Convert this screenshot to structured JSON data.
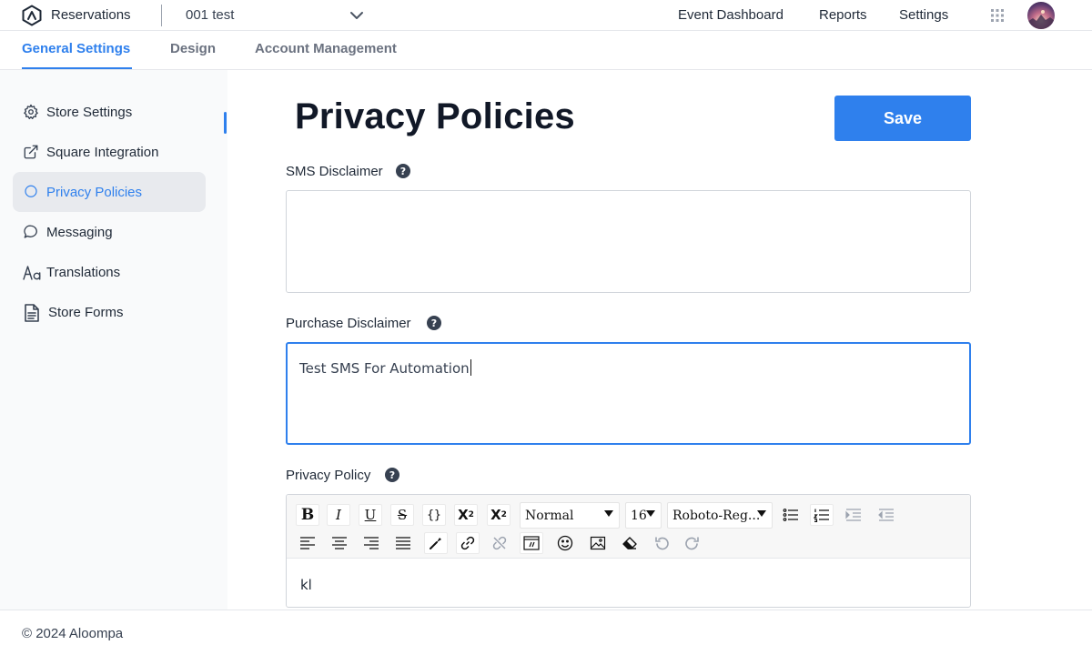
{
  "header": {
    "app_name": "Reservations",
    "store_name": "001 test",
    "nav": [
      "Event Dashboard",
      "Reports",
      "Settings"
    ]
  },
  "tabs": [
    {
      "label": "General Settings",
      "active": true
    },
    {
      "label": "Design",
      "active": false
    },
    {
      "label": "Account Management",
      "active": false
    }
  ],
  "sidebar": {
    "items": [
      {
        "label": "Store Settings",
        "icon": "gear-icon"
      },
      {
        "label": "Square Integration",
        "icon": "external-link-icon"
      },
      {
        "label": "Privacy Policies",
        "icon": "circle-icon",
        "active": true
      },
      {
        "label": "Messaging",
        "icon": "chat-bubble-icon"
      },
      {
        "label": "Translations",
        "icon": "font-aa-icon"
      },
      {
        "label": "Store Forms",
        "icon": "document-icon"
      }
    ]
  },
  "main": {
    "title": "Privacy Policies",
    "save_label": "Save",
    "sms_label": "SMS Disclaimer",
    "sms_value": "",
    "purchase_label": "Purchase Disclaimer",
    "purchase_value": "Test SMS For Automation",
    "privacy_label": "Privacy Policy",
    "privacy_value": "kl"
  },
  "editor": {
    "heading_select": "Normal",
    "size_select": "16",
    "font_select": "Roboto-Reg..."
  },
  "footer": {
    "copyright": "© 2024 Aloompa"
  },
  "colors": {
    "accent": "#2f80ed",
    "sidebar_bg": "#f9fafb",
    "active_item_bg": "#e8eaee"
  }
}
